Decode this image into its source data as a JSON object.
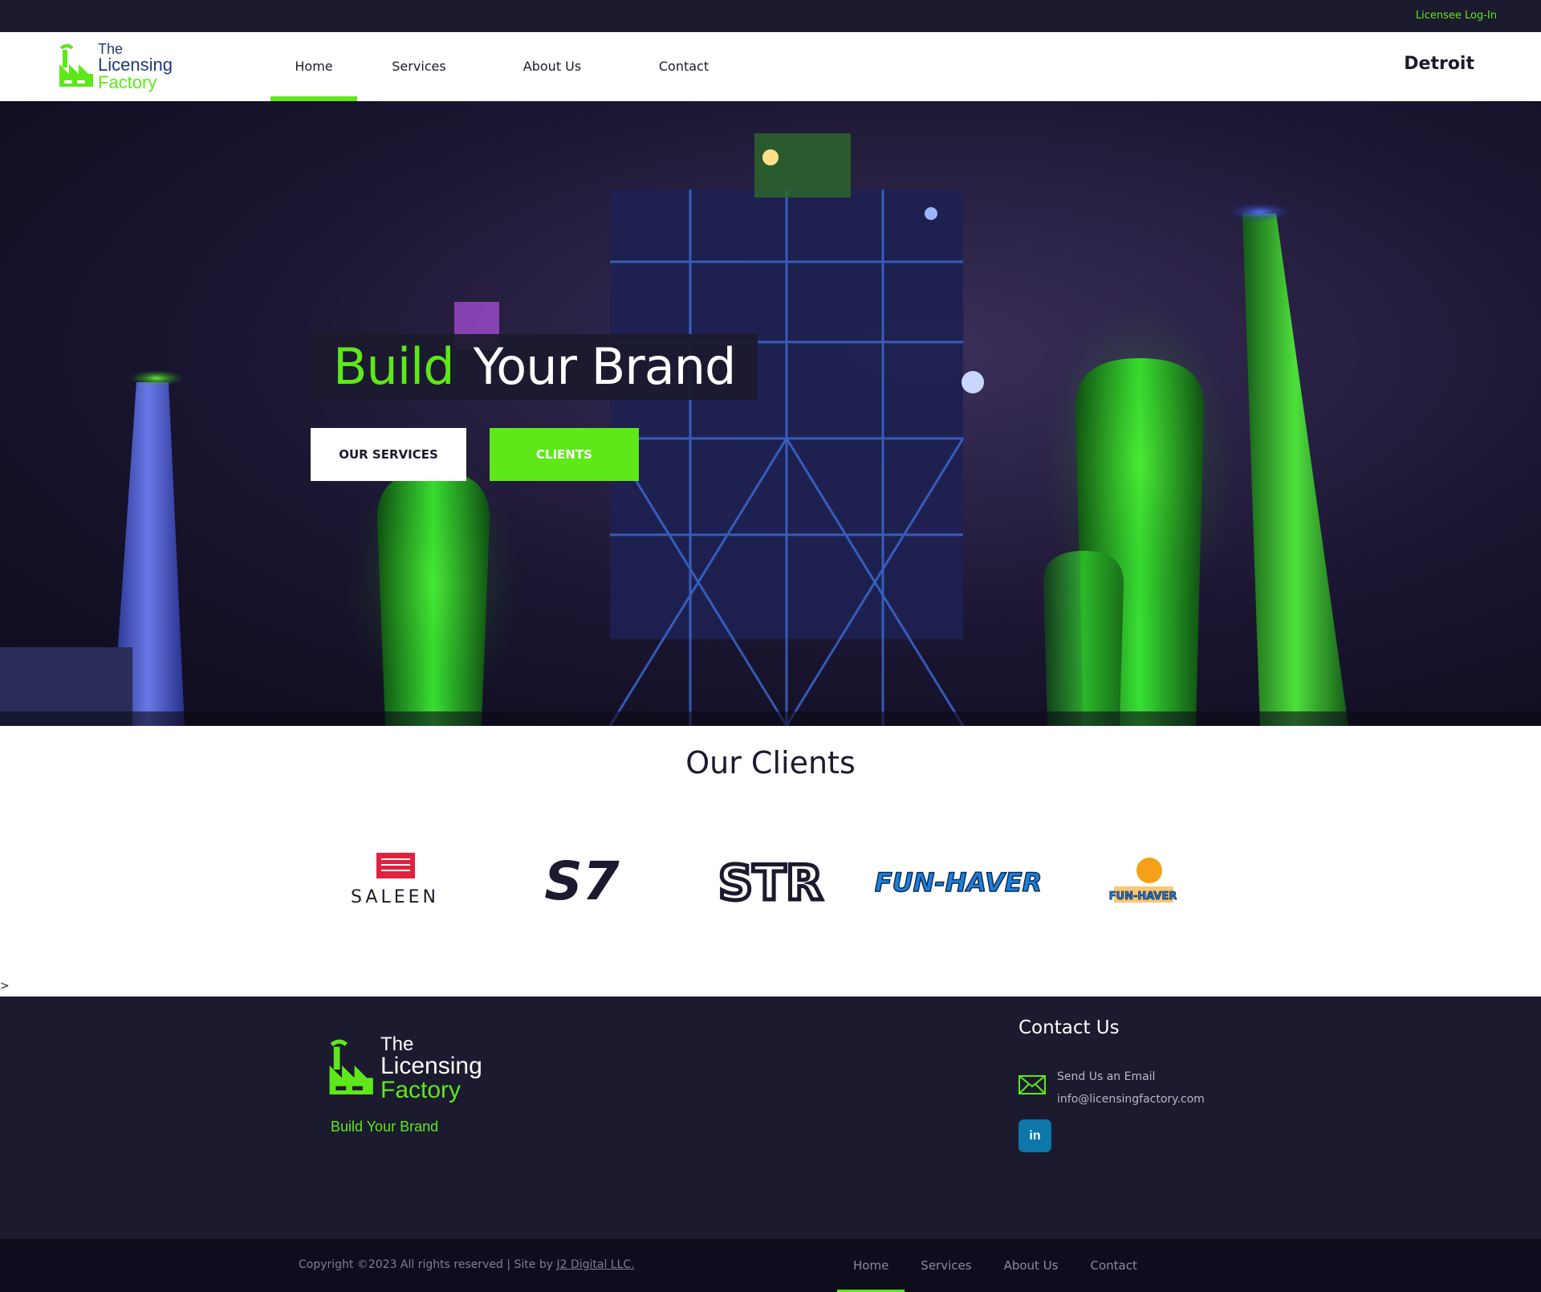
{
  "topbar": {
    "login_label": "Licensee Log-In"
  },
  "header": {
    "logo": {
      "line1": "The",
      "line2": "Licensing",
      "line3": "Factory"
    },
    "nav": [
      {
        "label": "Home",
        "active": true
      },
      {
        "label": "Services",
        "active": false
      },
      {
        "label": "About Us",
        "active": false
      },
      {
        "label": "Contact",
        "active": false
      }
    ],
    "city": "Detroit"
  },
  "hero": {
    "title_accent": "Build",
    "title_rest": "Your Brand",
    "buttons": {
      "services": "OUR SERVICES",
      "clients": "CLIENTS"
    }
  },
  "clients": {
    "title": "Our Clients",
    "logos": [
      {
        "name": "saleen-logo",
        "text": "SALEEN"
      },
      {
        "name": "s7-logo",
        "text": "S7"
      },
      {
        "name": "str-logo",
        "text": "STR"
      },
      {
        "name": "fun-haver-logo",
        "text": "FUN-HAVER"
      },
      {
        "name": "fun-haver-badge-logo",
        "text": "FUN-HAVER"
      }
    ]
  },
  "stray_char": ">",
  "footer": {
    "logo": {
      "line1": "The",
      "line2": "Licensing",
      "line3": "Factory"
    },
    "tagline": "Build Your Brand",
    "contact_title": "Contact Us",
    "email_label": "Send Us an Email",
    "email": "info@licensingfactory.com",
    "linkedin_label": "in"
  },
  "bottombar": {
    "copyright": "Copyright ©2023 All rights reserved | Site by ",
    "credit": "J2 Digital LLC.",
    "nav": [
      {
        "label": "Home",
        "active": true
      },
      {
        "label": "Services",
        "active": false
      },
      {
        "label": "About Us",
        "active": false
      },
      {
        "label": "Contact",
        "active": false
      }
    ]
  },
  "colors": {
    "brand_green": "#5ee81a",
    "navy": "#1b1a2e",
    "navy_dark": "#0e0d1e",
    "linkedin_blue": "#0e76a8"
  }
}
